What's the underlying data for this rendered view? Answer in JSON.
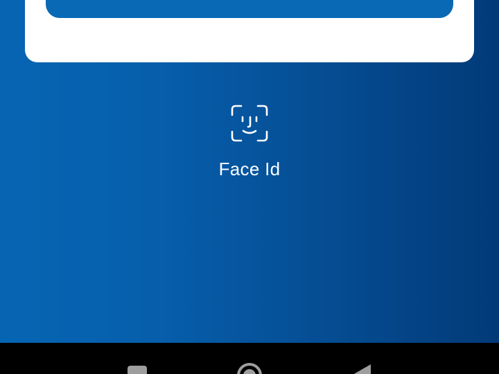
{
  "face_id": {
    "label": "Face Id",
    "icon": "face-id-icon"
  },
  "primary_button": {
    "label": ""
  },
  "navigation": {
    "recents_icon": "square-recents-icon",
    "home_icon": "circle-home-icon",
    "back_icon": "triangle-back-icon"
  },
  "colors": {
    "gradient_start": "#0665b3",
    "gradient_end": "#023a78",
    "button": "#0969b5",
    "card": "#ffffff",
    "text": "#ffffff",
    "nav_bar": "#000000",
    "nav_icons": "#9e9e9e"
  }
}
